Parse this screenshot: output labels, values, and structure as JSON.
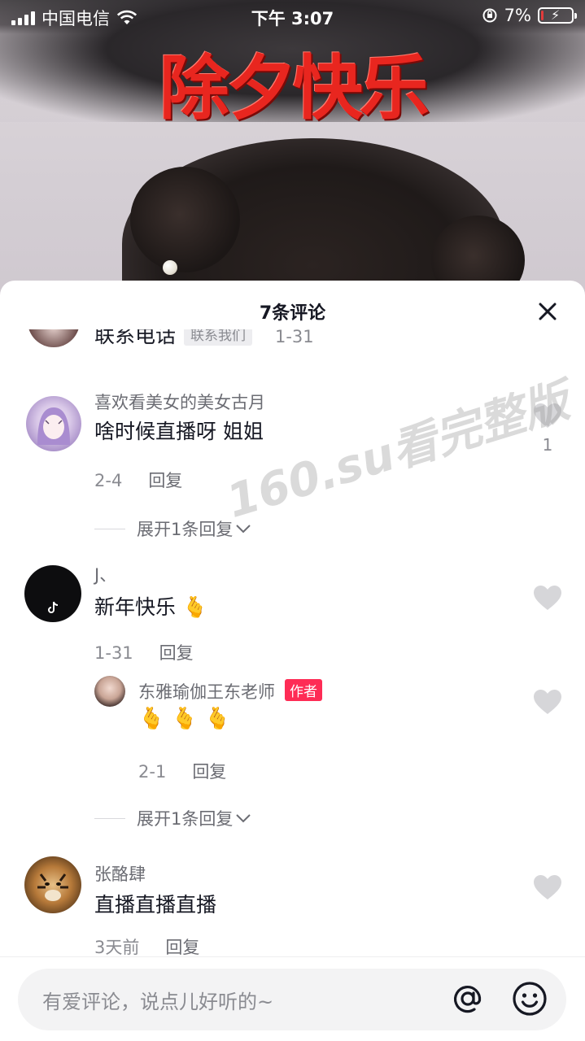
{
  "status_bar": {
    "carrier": "中国电信",
    "time": "下午 3:07",
    "battery_percent": "7%",
    "battery_level": 0.07
  },
  "video": {
    "title": "除夕快乐"
  },
  "comments_sheet": {
    "title": "7条评论",
    "close_icon": "close-icon",
    "comments": [
      {
        "username": "",
        "content": "联系电话",
        "tag": "联系我们",
        "time": "1-31"
      },
      {
        "username": "喜欢看美女的美女古月",
        "content": "啥时候直播呀 姐姐",
        "time": "2-4",
        "reply_label": "回复",
        "likes": "1",
        "expand_label": "展开1条回复"
      },
      {
        "username": "J、",
        "content": "新年快乐 🫰",
        "time": "1-31",
        "reply_label": "回复",
        "expand_label": "展开1条回复",
        "replies": [
          {
            "username": "东雅瑜伽王东老师",
            "badge": "作者",
            "content": "🫰 🫰 🫰",
            "time": "2-1",
            "reply_label": "回复"
          }
        ]
      },
      {
        "username": "张酪肆",
        "content": "直播直播直播",
        "time": "3天前",
        "reply_label": "回复"
      }
    ]
  },
  "watermark": "160.su看完整版",
  "input": {
    "placeholder": "有爱评论，说点儿好听的~",
    "at_icon": "at-icon",
    "emoji_icon": "emoji-icon"
  }
}
